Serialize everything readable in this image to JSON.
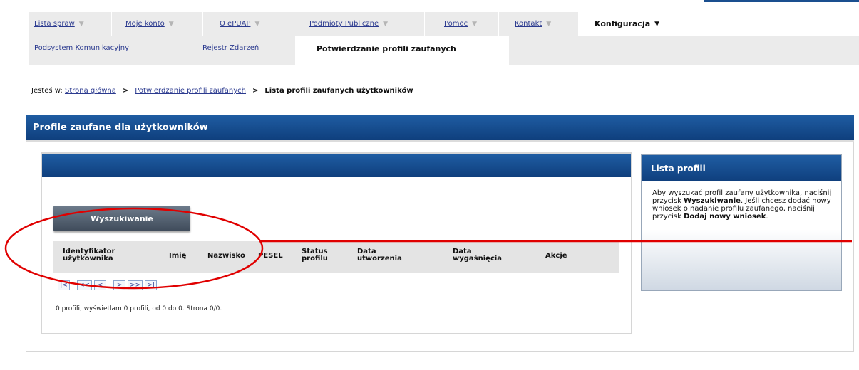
{
  "nav_primary": [
    {
      "label": "Lista spraw",
      "active": false
    },
    {
      "label": "Moje konto",
      "active": false
    },
    {
      "label": "O ePUAP",
      "active": false
    },
    {
      "label": "Podmioty Publiczne",
      "active": false
    },
    {
      "label": "Pomoc",
      "active": false
    },
    {
      "label": "Kontakt",
      "active": false
    },
    {
      "label": "Konfiguracja",
      "active": true
    }
  ],
  "nav_secondary": [
    {
      "label": "Podsystem Komunikacyjny",
      "active": false
    },
    {
      "label": "Rejestr Zdarzeń",
      "active": false
    },
    {
      "label": "Potwierdzanie profili zaufanych",
      "active": true
    }
  ],
  "breadcrumb": {
    "prefix": "Jesteś w:",
    "home": "Strona główna",
    "middle": "Potwierdzanie profili zaufanych",
    "current": "Lista profili zaufanych użytkowników",
    "separator": ">"
  },
  "main": {
    "title": "Profile zaufane dla użytkowników",
    "search_button": "Wyszukiwanie",
    "table_headers": [
      {
        "line1": "Identyfikator",
        "line2": "użytkownika"
      },
      {
        "line1": "Imię",
        "line2": ""
      },
      {
        "line1": "Nazwisko",
        "line2": ""
      },
      {
        "line1": "PESEL",
        "line2": ""
      },
      {
        "line1": "Status",
        "line2": "profilu"
      },
      {
        "line1": "Data",
        "line2": "utworzenia"
      },
      {
        "line1": "Data",
        "line2": "wygaśnięcia"
      },
      {
        "line1": "Akcje",
        "line2": ""
      }
    ],
    "pager": [
      "|<",
      "<<",
      "<",
      ">",
      ">>",
      ">|"
    ],
    "summary": "0 profili, wyświetlam 0 profili, od 0 do 0. Strona 0/0."
  },
  "side": {
    "title": "Lista profili",
    "text_1": "Aby wyszukać profil zaufany użytkownika, naciśnij przycisk ",
    "bold_1": "Wyszukiwanie",
    "text_2": ". Jeśli chcesz dodać nowy wniosek o nadanie profilu zaufanego, naciśnij przycisk ",
    "bold_2": "Dodaj nowy wniosek",
    "text_3": "."
  },
  "colors": {
    "header_blue": "#14498c",
    "link": "#2b3a8f",
    "annotation": "#e00000"
  }
}
